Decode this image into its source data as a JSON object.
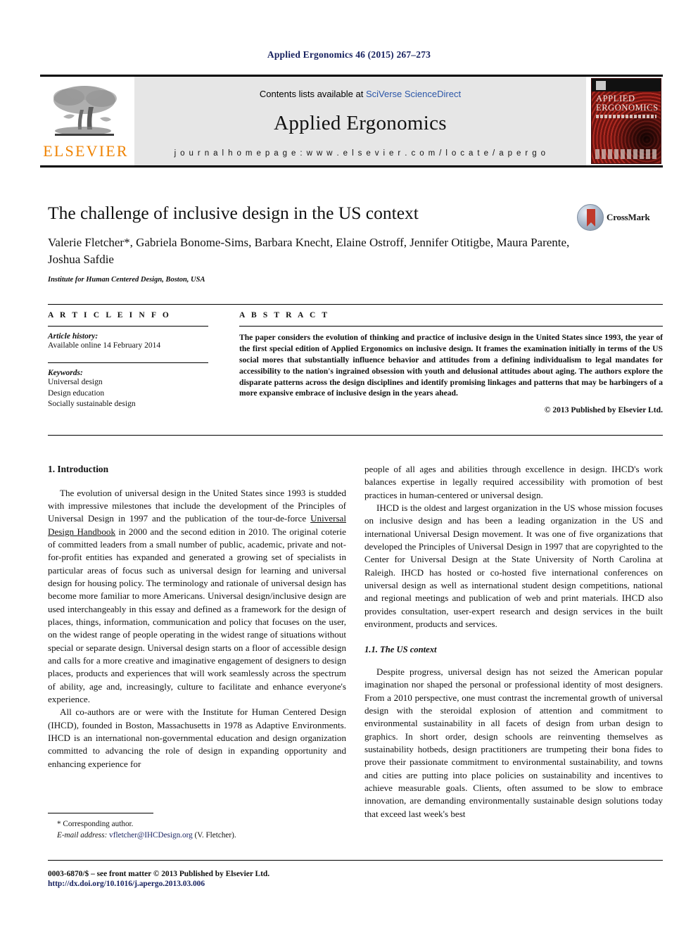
{
  "running_head": "Applied Ergonomics 46 (2015) 267–273",
  "masthead": {
    "contents_prefix": "Contents lists available at ",
    "sciencedirect_link": "SciVerse ScienceDirect",
    "journal_title": "Applied Ergonomics",
    "homepage_label": "j o u r n a l   h o m e p a g e :   w w w . e l s e v i e r . c o m / l o c a t e / a p e r g o",
    "publisher_wordmark": "ELSEVIER",
    "cover": {
      "title_line1": "APPLIED",
      "title_line2": "ERGONOMICS"
    }
  },
  "article": {
    "title": "The challenge of inclusive design in the US context",
    "authors": "Valerie Fletcher*, Gabriela Bonome-Sims, Barbara Knecht, Elaine Ostroff, Jennifer Otitigbe, Maura Parente, Joshua Safdie",
    "affiliation": "Institute for Human Centered Design, Boston, USA",
    "crossmark_label": "CrossMark"
  },
  "article_info": {
    "heading": "A R T I C L E   I N F O",
    "history_label": "Article history:",
    "history_value": "Available online 14 February 2014",
    "keywords_label": "Keywords:",
    "keywords": [
      "Universal design",
      "Design education",
      "Socially sustainable design"
    ]
  },
  "abstract": {
    "heading": "A B S T R A C T",
    "text": "The paper considers the evolution of thinking and practice of inclusive design in the United States since 1993, the year of the first special edition of Applied Ergonomics on inclusive design. It frames the examination initially in terms of the US social mores that substantially influence behavior and attitudes from a defining individualism to legal mandates for accessibility to the nation's ingrained obsession with youth and delusional attitudes about aging. The authors explore the disparate patterns across the design disciplines and identify promising linkages and patterns that may be harbingers of a more expansive embrace of inclusive design in the years ahead.",
    "copyright": "© 2013 Published by Elsevier Ltd."
  },
  "body": {
    "section1_heading": "1.  Introduction",
    "left_para1_a": "The evolution of universal design in the United States since 1993 is studded with impressive milestones that include the development of the Principles of Universal Design in 1997 and the publication of the tour-de-force ",
    "left_para1_booktitle": "Universal Design Handbook",
    "left_para1_b": " in 2000 and the second edition in 2010. The original coterie of committed leaders from a small number of public, academic, private and not-for-profit entities has expanded and generated a growing set of specialists in particular areas of focus such as universal design for learning and universal design for housing policy. The terminology and rationale of universal design has become more familiar to more Americans. Universal design/inclusive design are used interchangeably in this essay and defined as a framework for the design of places, things, information, communication and policy that focuses on the user, on the widest range of people operating in the widest range of situations without special or separate design. Universal design starts on a floor of accessible design and calls for a more creative and imaginative engagement of designers to design places, products and experiences that will work seamlessly across the spectrum of ability, age and, increasingly, culture to facilitate and enhance everyone's experience.",
    "left_para2": "All co-authors are or were with the Institute for Human Centered Design (IHCD), founded in Boston, Massachusetts in 1978 as Adaptive Environments. IHCD is an international non-governmental education and design organization committed to advancing the role of design in expanding opportunity and enhancing experience for",
    "right_para1": "people of all ages and abilities through excellence in design. IHCD's work balances expertise in legally required accessibility with promotion of best practices in human-centered or universal design.",
    "right_para2": "IHCD is the oldest and largest organization in the US whose mission focuses on inclusive design and has been a leading organization in the US and international Universal Design movement. It was one of five organizations that developed the Principles of Universal Design in 1997 that are copyrighted to the Center for Universal Design at the State University of North Carolina at Raleigh. IHCD has hosted or co-hosted five international conferences on universal design as well as international student design competitions, national and regional meetings and publication of web and print materials. IHCD also provides consultation, user-expert research and design services in the built environment, products and services.",
    "subsection11_heading": "1.1.  The US context",
    "right_para3": "Despite progress, universal design has not seized the American popular imagination nor shaped the personal or professional identity of most designers. From a 2010 perspective, one must contrast the incremental growth of universal design with the steroidal explosion of attention and commitment to environmental sustainability in all facets of design from urban design to graphics. In short order, design schools are reinventing themselves as sustainability hotbeds, design practitioners are trumpeting their bona fides to prove their passionate commitment to environmental sustainability, and towns and cities are putting into place policies on sustainability and incentives to achieve measurable goals. Clients, often assumed to be slow to embrace innovation, are demanding environmentally sustainable design solutions today that exceed last week's best"
  },
  "footnote": {
    "corresponding_author": "* Corresponding author.",
    "email_label": "E-mail address:",
    "email_address": "vfletcher@IHCDesign.org",
    "email_suffix": " (V. Fletcher)."
  },
  "page_footer": {
    "front_matter": "0003-6870/$ – see front matter © 2013 Published by Elsevier Ltd.",
    "doi": "http://dx.doi.org/10.1016/j.apergo.2013.03.006"
  },
  "colors": {
    "link_blue": "#2b56a8",
    "navy": "#16205e",
    "elsevier_orange": "#ef8200",
    "masthead_grey": "#e6e6e6"
  }
}
